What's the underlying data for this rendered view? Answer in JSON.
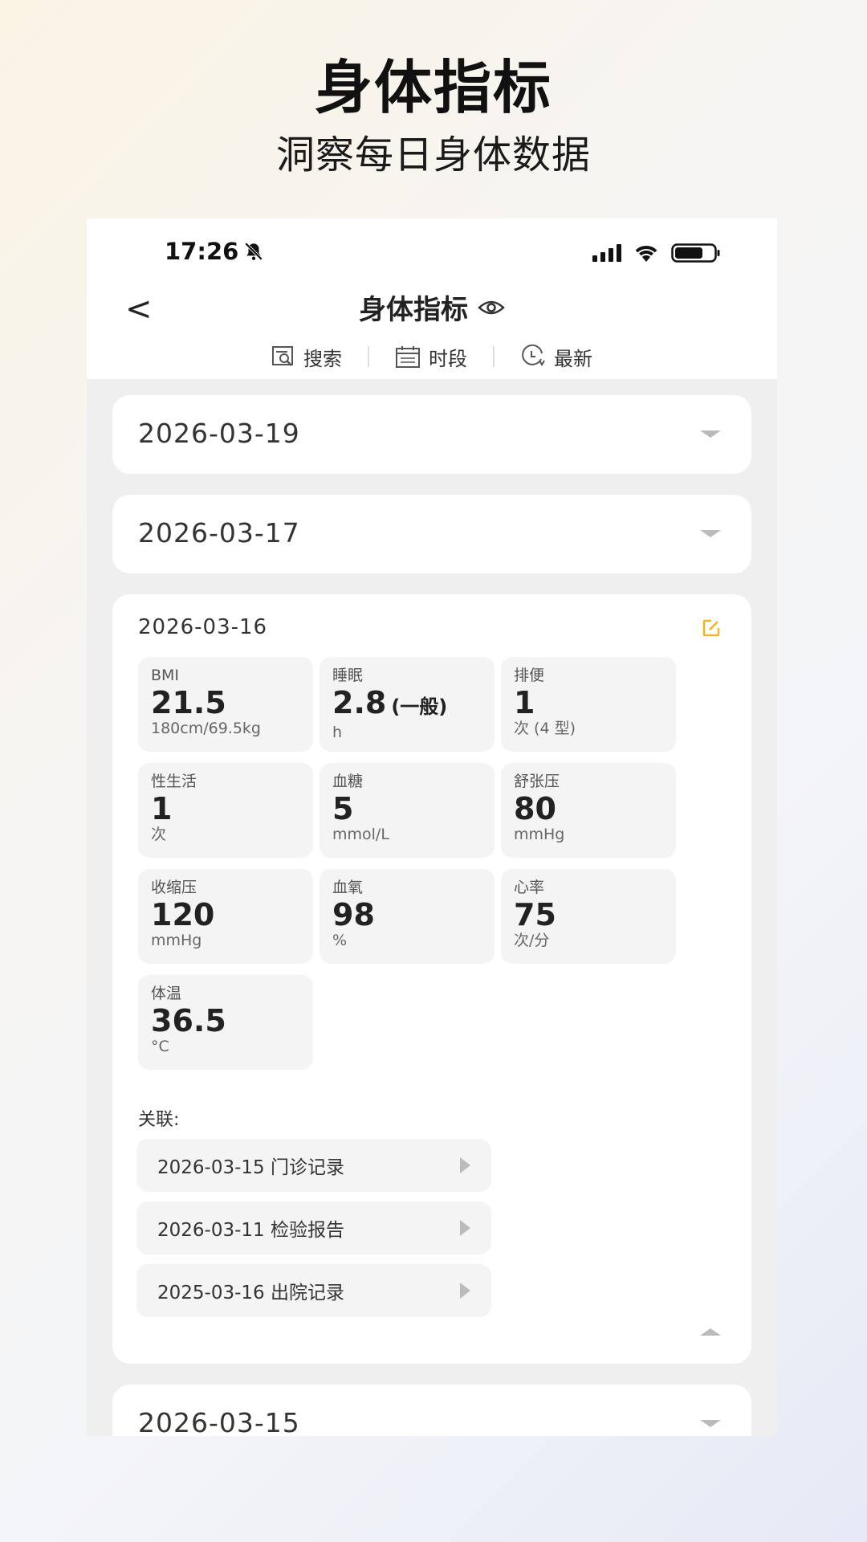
{
  "promo": {
    "title": "身体指标",
    "subtitle": "洞察每日身体数据"
  },
  "status_bar": {
    "time": "17:26",
    "bell_icon": "bell-muted-icon"
  },
  "nav": {
    "back_label": "<",
    "title": "身体指标"
  },
  "toolbar": {
    "items": [
      {
        "label": "搜索",
        "icon": "search-doc-icon"
      },
      {
        "label": "时段",
        "icon": "calendar-icon"
      },
      {
        "label": "最新",
        "icon": "clock-icon"
      }
    ]
  },
  "records": {
    "r1": {
      "date": "2026-03-19"
    },
    "r2": {
      "date": "2026-03-17"
    },
    "r3": {
      "date": "2026-03-16",
      "tiles": [
        {
          "label": "BMI",
          "value": "21.5",
          "extra": "",
          "unit": "180cm/69.5kg"
        },
        {
          "label": "睡眠",
          "value": "2.8",
          "extra": "(一般)",
          "unit": "h"
        },
        {
          "label": "排便",
          "value": "1",
          "extra": "",
          "unit": "次 (4 型)"
        },
        {
          "label": "性生活",
          "value": "1",
          "extra": "",
          "unit": "次"
        },
        {
          "label": "血糖",
          "value": "5",
          "extra": "",
          "unit": "mmol/L"
        },
        {
          "label": "舒张压",
          "value": "80",
          "extra": "",
          "unit": "mmHg"
        },
        {
          "label": "收缩压",
          "value": "120",
          "extra": "",
          "unit": "mmHg"
        },
        {
          "label": "血氧",
          "value": "98",
          "extra": "",
          "unit": "%"
        },
        {
          "label": "心率",
          "value": "75",
          "extra": "",
          "unit": "次/分"
        },
        {
          "label": "体温",
          "value": "36.5",
          "extra": "",
          "unit": "°C"
        }
      ],
      "related_label": "关联:",
      "related": [
        {
          "text": "2026-03-15 门诊记录"
        },
        {
          "text": "2026-03-11 检验报告"
        },
        {
          "text": "2025-03-16 出院记录"
        }
      ]
    },
    "r4": {
      "date": "2026-03-15"
    }
  },
  "colors": {
    "accent_edit": "#f0b429",
    "card_bg": "#ffffff",
    "tile_bg": "#f4f4f4"
  }
}
